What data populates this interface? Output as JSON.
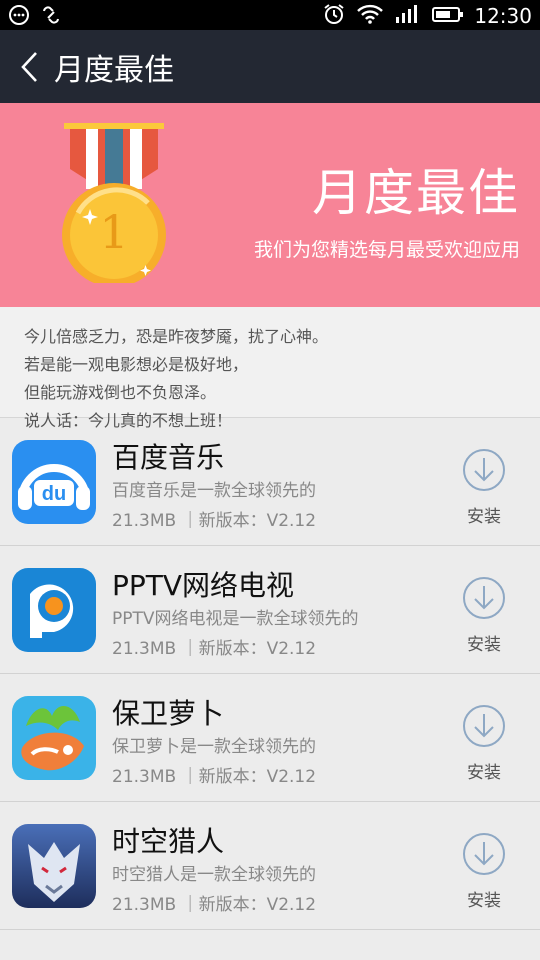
{
  "status_bar": {
    "time": "12:30"
  },
  "app_bar": {
    "title": "月度最佳"
  },
  "banner": {
    "title": "月度最佳",
    "subtitle": "我们为您精选每月最受欢迎应用",
    "medal_number": "1"
  },
  "intro": {
    "lines": [
      "今儿倍感乏力，恐是昨夜梦魇，扰了心神。",
      "若是能一观电影想必是极好地，",
      "但能玩游戏倒也不负恩泽。",
      "说人话：今儿真的不想上班！"
    ]
  },
  "apps": [
    {
      "name": "百度音乐",
      "description": "百度音乐是一款全球领先的",
      "meta": "21.3MB ｜新版本：V2.12",
      "install_label": "安装",
      "icon": "baidu-music-icon"
    },
    {
      "name": "PPTV网络电视",
      "description": "PPTV网络电视是一款全球领先的",
      "meta": "21.3MB ｜新版本：V2.12",
      "install_label": "安装",
      "icon": "pptv-icon"
    },
    {
      "name": "保卫萝卜",
      "description": "保卫萝卜是一款全球领先的",
      "meta": "21.3MB ｜新版本：V2.12",
      "install_label": "安装",
      "icon": "carrot-game-icon"
    },
    {
      "name": "时空猎人",
      "description": "时空猎人是一款全球领先的",
      "meta": "21.3MB ｜新版本：V2.12",
      "install_label": "安装",
      "icon": "time-hunter-icon"
    }
  ],
  "colors": {
    "banner": "#f78497",
    "app_bar": "#232833",
    "accent": "#8ea8c4"
  }
}
